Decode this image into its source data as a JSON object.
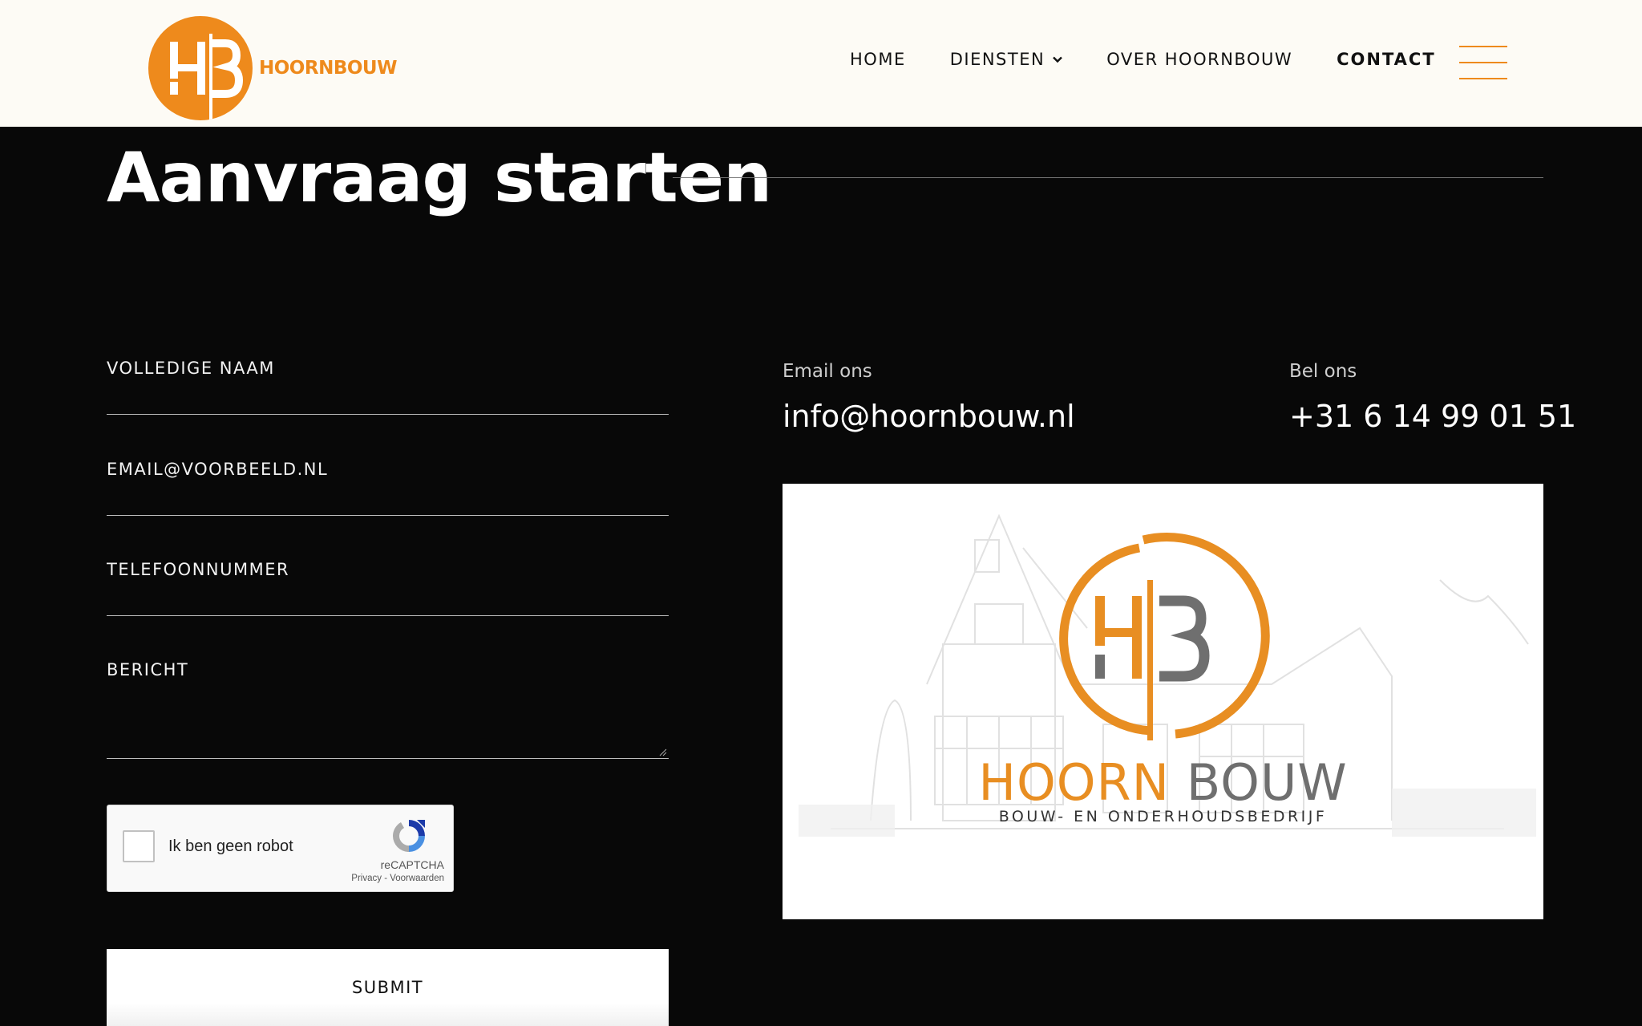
{
  "header": {
    "brand": "HOORNBOUW",
    "logo_initials": "HB",
    "nav": [
      {
        "label": "HOME"
      },
      {
        "label": "DIENSTEN"
      },
      {
        "label": "OVER HOORNBOUW"
      },
      {
        "label": "CONTACT"
      }
    ]
  },
  "page": {
    "title": "Aanvraag starten"
  },
  "form": {
    "name_placeholder": "VOLLEDIGE NAAM",
    "email_placeholder": "EMAIL@VOORBEELD.NL",
    "phone_placeholder": "TELEFOONNUMMER",
    "message_placeholder": "BERICHT",
    "recaptcha": {
      "label": "Ik ben geen robot",
      "brand": "reCAPTCHA",
      "links": "Privacy - Voorwaarden"
    },
    "submit_label": "SUBMIT"
  },
  "contact": {
    "email_label": "Email ons",
    "email_value": "info@hoornbouw.nl",
    "phone_label": "Bel ons",
    "phone_value": "+31 6 14 99 01 51"
  },
  "card": {
    "name_part1": "HOORN",
    "name_part2": "BOUW",
    "tagline": "BOUW- EN ONDERHOUDSBEDRIJF"
  },
  "colors": {
    "accent": "#ee8a1c",
    "header_bg": "#fdfbf5",
    "page_bg": "#080808"
  }
}
